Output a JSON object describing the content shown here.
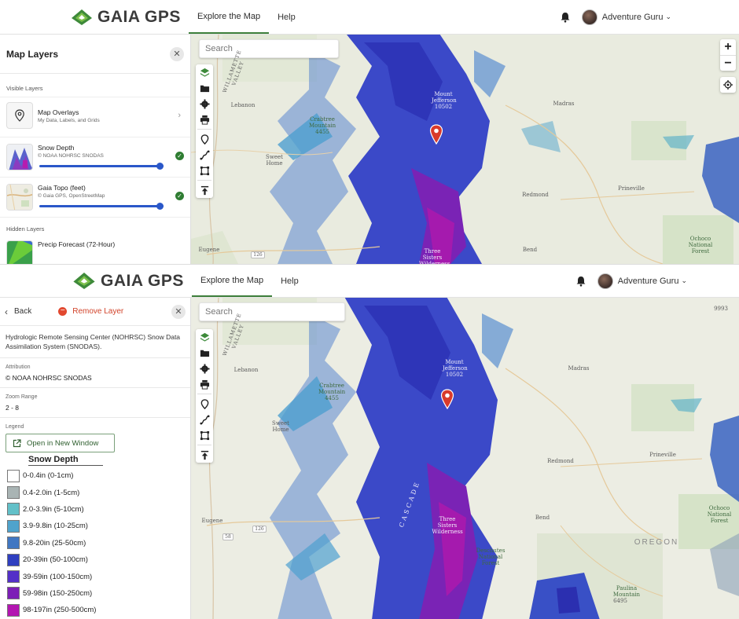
{
  "app": {
    "logo_text": "GAIA GPS",
    "nav": [
      "Explore the Map",
      "Help"
    ],
    "user_name": "Adventure Guru",
    "accent_color": "#3d7f3a"
  },
  "map": {
    "search_placeholder": "Search",
    "labels_top": {
      "willamette_valley": "WILLAMETTE VALLEY",
      "mount_jefferson": "Mount Jefferson 10502",
      "crabtree_mountain": "Crabtree Mountain 4455",
      "lebanon": "Lebanon",
      "sweet_home": "Sweet Home",
      "madras": "Madras",
      "redmond": "Redmond",
      "prineville": "Prineville",
      "bend": "Bend",
      "eugene": "Eugene",
      "three_sisters": "Three Sisters Wilderness",
      "ochoco": "Ochoco National Forest",
      "highway": "126"
    },
    "labels_bottom_extra": {
      "oregon": "OREGON",
      "deschutes": "Deschutes National Forest",
      "cascade": "CASCADE",
      "paulina": "Paulina Mountain",
      "elev_9993": "9993",
      "elev_6495": "6495",
      "highway": "58"
    }
  },
  "panel1": {
    "title": "Map Layers",
    "visible_label": "Visible Layers",
    "overlays_title": "Map Overlays",
    "overlays_sub": "My Data, Labels, and Grids",
    "layers": [
      {
        "title": "Snow Depth",
        "source": "© NOAA NOHRSC SNODAS",
        "opacity": 1.0
      },
      {
        "title": "Gaia Topo (feet)",
        "source": "© Gaia GPS, OpenStreetMap",
        "opacity": 1.0
      }
    ],
    "hidden_label": "Hidden Layers",
    "hidden_layer": "Precip Forecast (72-Hour)"
  },
  "panel2": {
    "back": "Back",
    "remove": "Remove Layer",
    "description": "Hydrologic Remote Sensing Center (NOHRSC) Snow Data Assimilation System (SNODAS).",
    "attribution_label": "Attribution",
    "attribution": "© NOAA NOHRSC SNODAS",
    "zoom_label": "Zoom Range",
    "zoom_range": "2 - 8",
    "legend_label": "Legend",
    "open_window": "Open in New Window",
    "legend_title": "Snow Depth",
    "legend": [
      {
        "label": "0-0.4in (0-1cm)",
        "color": "#ffffff"
      },
      {
        "label": "0.4-2.0in (1-5cm)",
        "color": "#a9b4b4"
      },
      {
        "label": "2.0-3.9in (5-10cm)",
        "color": "#62c0c8"
      },
      {
        "label": "3.9-9.8in (10-25cm)",
        "color": "#4fa3cc"
      },
      {
        "label": "9.8-20in (25-50cm)",
        "color": "#4177c2"
      },
      {
        "label": "20-39in (50-100cm)",
        "color": "#2f3fc0"
      },
      {
        "label": "39-59in (100-150cm)",
        "color": "#5330c8"
      },
      {
        "label": "59-98in (150-250cm)",
        "color": "#7c1fb6"
      },
      {
        "label": "98-197in (250-500cm)",
        "color": "#b316b1"
      }
    ]
  }
}
